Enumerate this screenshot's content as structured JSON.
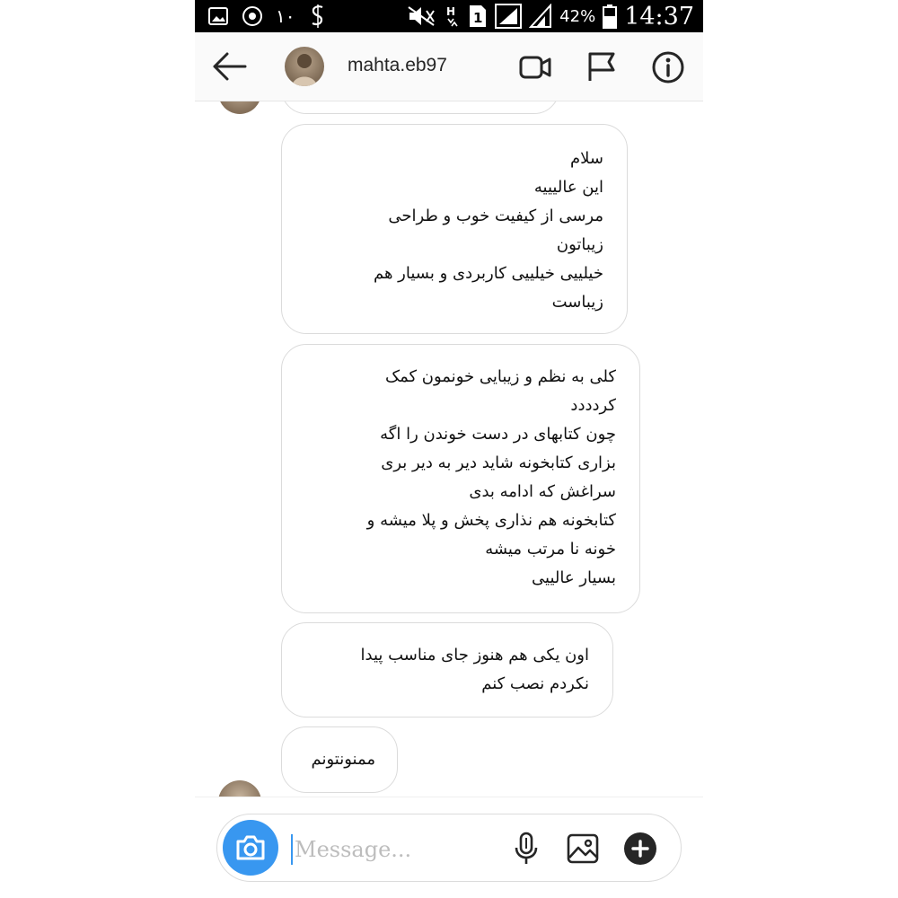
{
  "status_bar": {
    "left_glyph": "١٠",
    "battery_percent": "42%",
    "time": "14:37",
    "sim_label": "1"
  },
  "header": {
    "username": "mahta.eb97",
    "icons": [
      "back-arrow-icon",
      "video-call-icon",
      "flag-icon",
      "info-icon"
    ]
  },
  "messages": [
    {
      "text": "سلام\nاین عالیییه\nمرسی از کیفیت خوب و طراحی\nزیباتون\nخیلییی خیلییی کاربردی و بسیار هم\nزیباست"
    },
    {
      "text": "کلی به نظم و زیبایی خونمون کمک\nکردددد\nچون کتابهای در دست خوندن را اگه\nبزاری کتابخونه شاید دیر به دیر بری\nسراغش که ادامه بدی\nکتابخونه هم نذاری پخش و پلا میشه و\nخونه نا مرتب میشه\nبسیار عالییی"
    },
    {
      "text": "اون یکی هم هنوز جای مناسب پیدا\nنکردم نصب کنم"
    },
    {
      "text": "ممنونتونم"
    }
  ],
  "composer": {
    "placeholder": "Message...",
    "value": "",
    "icons": [
      "camera-icon",
      "microphone-icon",
      "gallery-icon",
      "plus-icon"
    ]
  },
  "colors": {
    "accent": "#3897f0",
    "bubble_border": "#dbdbdb",
    "header_bg": "#fafafa"
  }
}
